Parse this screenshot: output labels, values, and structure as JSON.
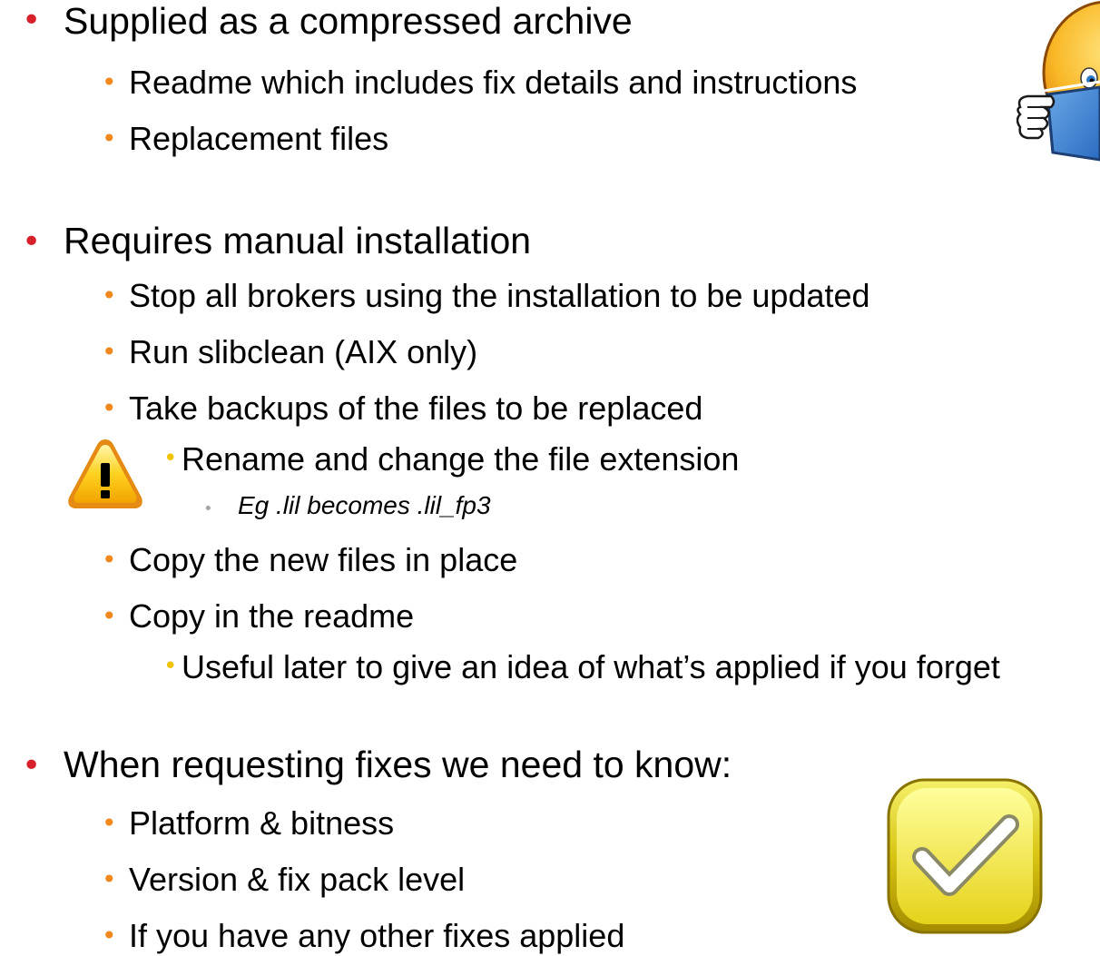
{
  "sections": [
    {
      "heading": "Supplied as a compressed archive",
      "items": [
        {
          "text": "Readme which includes fix details and instructions"
        },
        {
          "text": "Replacement files"
        }
      ]
    },
    {
      "heading": "Requires manual installation",
      "items": [
        {
          "text": "Stop all brokers using the installation to be updated"
        },
        {
          "text": "Run slibclean (AIX only)"
        },
        {
          "text": "Take backups of the files to be replaced"
        },
        {
          "text": "Rename and change the file extension",
          "level": 3
        },
        {
          "text": "Eg .lil becomes .lil_fp3",
          "level": 4
        },
        {
          "text": "Copy the new files in place"
        },
        {
          "text": "Copy in the readme"
        },
        {
          "text": "Useful later to give an idea of what’s applied if you forget",
          "level": 3
        }
      ]
    },
    {
      "heading": "When requesting fixes we need to know:",
      "items": [
        {
          "text": "Platform & bitness"
        },
        {
          "text": "Version & fix pack level"
        },
        {
          "text": "If you have any other fixes applied"
        }
      ]
    }
  ],
  "bullet_colors": {
    "level1": "#d7202a",
    "level2": "#f0881d",
    "level3": "#f2c400",
    "level4": "#a6a6a6"
  },
  "icons": {
    "reading": "reading-character-icon",
    "warning": "warning-icon",
    "check": "checkmark-icon"
  }
}
